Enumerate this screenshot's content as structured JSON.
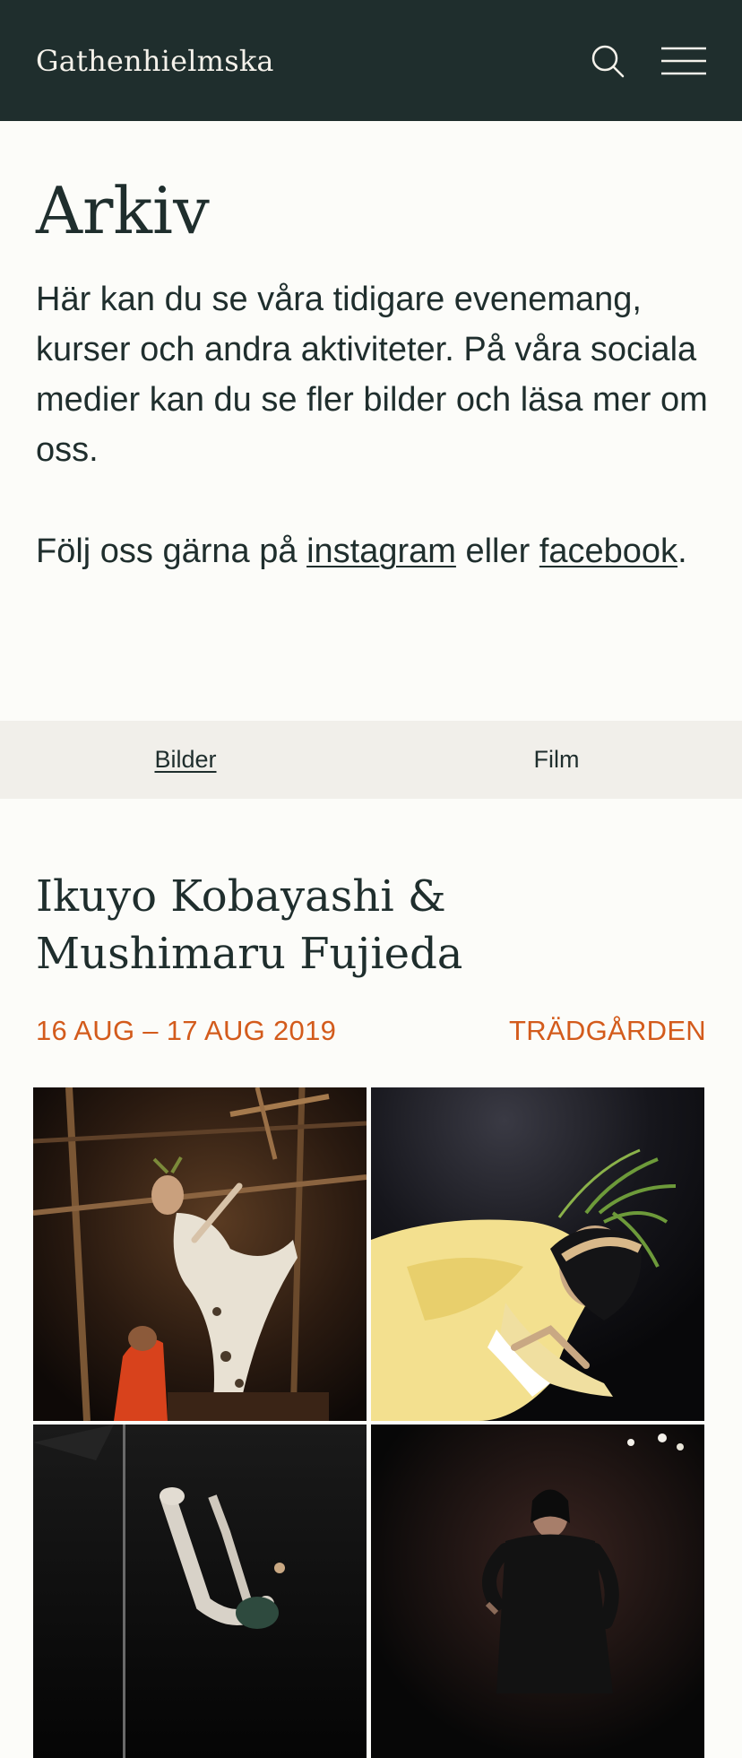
{
  "header": {
    "brand": "Gathenhielmska",
    "icons": {
      "search": "search-icon",
      "menu": "hamburger-menu-icon"
    }
  },
  "page": {
    "title": "Arkiv",
    "intro": "Här kan du se våra tidigare evenemang, kurser och andra aktiviteter. På våra sociala medier kan du se fler bilder och läsa mer om oss.",
    "follow_prefix": "Följ oss gärna på ",
    "instagram_label": "instagram",
    "follow_middle": " eller ",
    "facebook_label": "facebook",
    "follow_suffix": "."
  },
  "tabs": [
    {
      "label": "Bilder",
      "active": true
    },
    {
      "label": "Film",
      "active": false
    }
  ],
  "event": {
    "title": "Ikuyo Kobayashi & Mushimaru Fujieda",
    "dates": "16 AUG – 17 AUG 2019",
    "location": "TRÄDGÅRDEN"
  },
  "colors": {
    "header_bg": "#1f2e2d",
    "accent": "#d35b1c",
    "tab_bar_bg": "#f1efea",
    "page_bg": "#fcfcf9"
  }
}
